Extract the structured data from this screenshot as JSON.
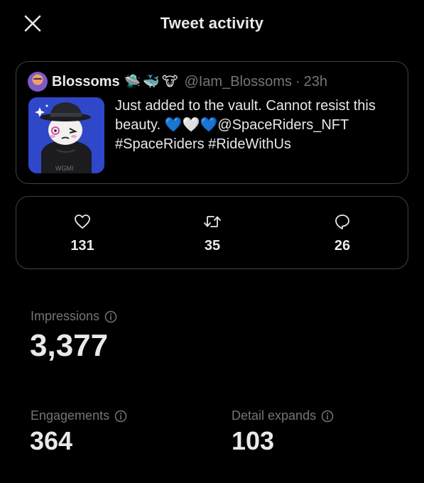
{
  "header": {
    "title": "Tweet activity",
    "close_icon": "close-icon"
  },
  "tweet": {
    "display_name": "Blossoms",
    "name_emojis": [
      "🛸",
      "🐳",
      "🐮"
    ],
    "handle": "@Iam_Blossoms",
    "separator": "·",
    "time": "23h",
    "text_line1": "Just added to the vault. Cannot resist this",
    "text_line2_prefix": "beauty. ",
    "hearts": [
      "💙",
      "🤍",
      "💙"
    ],
    "mention": "@SpaceRiders_NFT",
    "text_line3": "#SpaceRiders #RideWithUs",
    "image_watermark": "WGMI"
  },
  "stats": {
    "likes": {
      "icon": "heart-icon",
      "value": "131"
    },
    "retweets": {
      "icon": "retweet-icon",
      "value": "35"
    },
    "replies": {
      "icon": "reply-icon",
      "value": "26"
    }
  },
  "metrics": {
    "impressions": {
      "label": "Impressions",
      "value": "3,377"
    },
    "engagements": {
      "label": "Engagements",
      "value": "364"
    },
    "detail_expands": {
      "label": "Detail expands",
      "value": "103"
    }
  },
  "colors": {
    "background": "#000000",
    "text_primary": "#e7e9ea",
    "text_secondary": "#71767b",
    "border": "#3e4144"
  }
}
